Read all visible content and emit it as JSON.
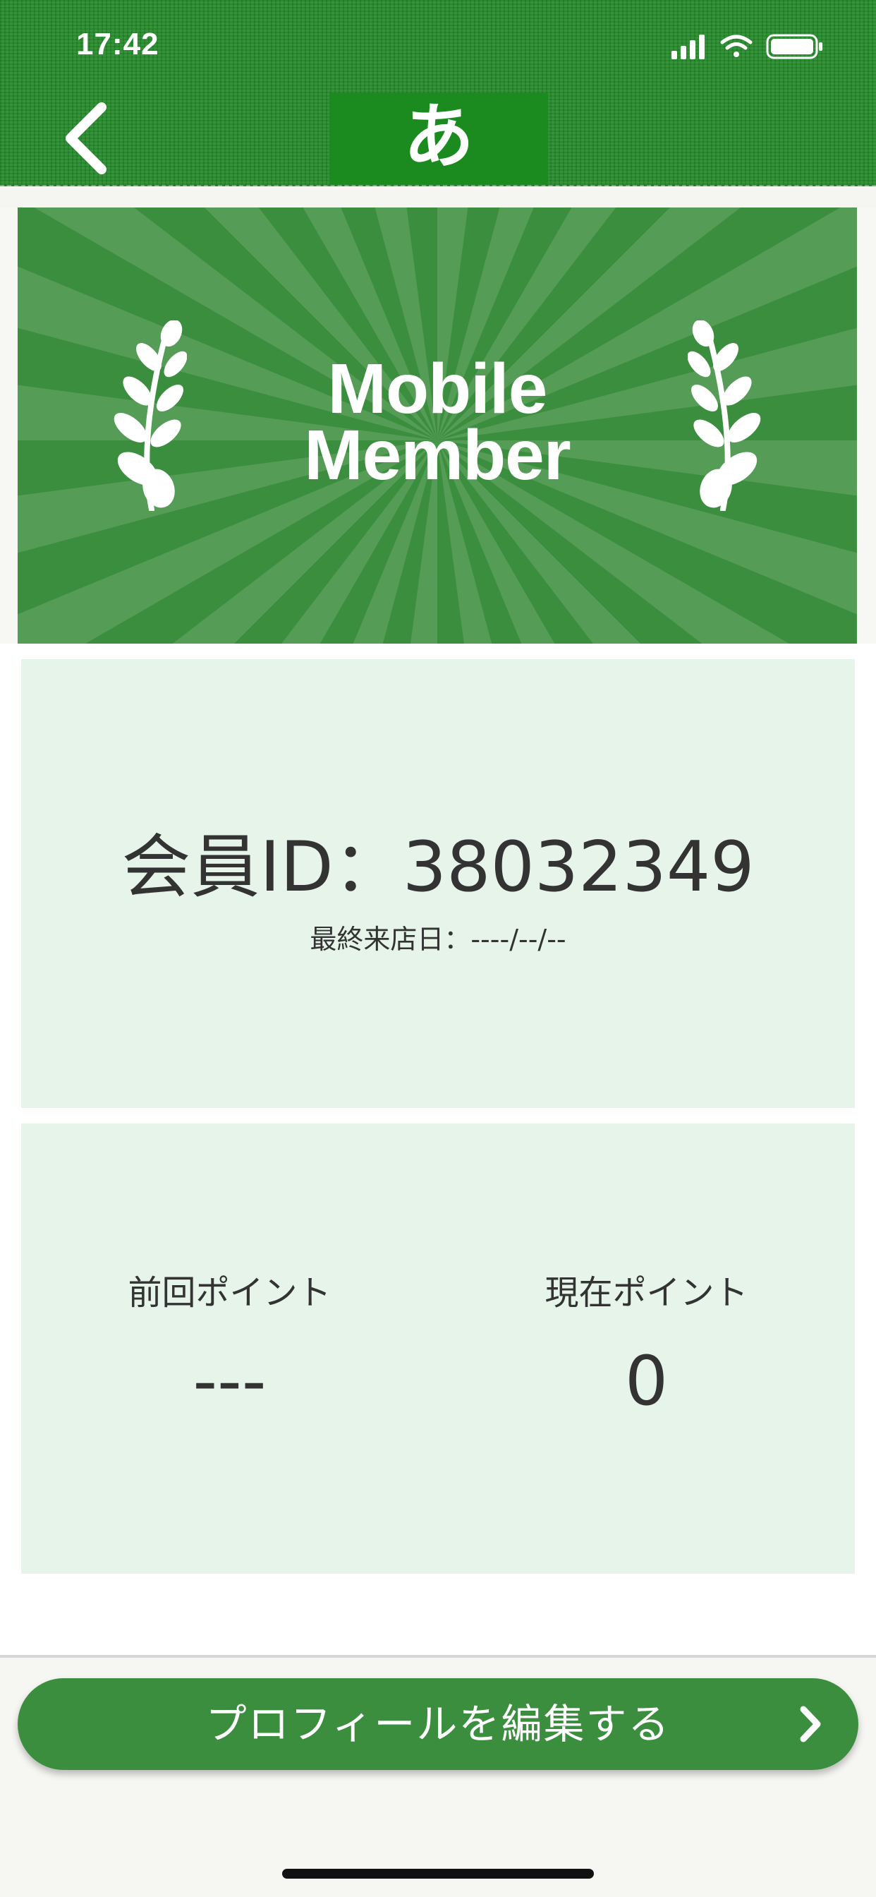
{
  "status_bar": {
    "time": "17:42"
  },
  "header": {
    "logo_text": "あ"
  },
  "banner": {
    "title_line1": "Mobile",
    "title_line2": "Member"
  },
  "member": {
    "id_text": "会員ID：38032349",
    "last_visit_text": "最終来店日：----/--/--"
  },
  "points": {
    "previous_label": "前回ポイント",
    "previous_value": "---",
    "current_label": "現在ポイント",
    "current_value": "0"
  },
  "footer": {
    "edit_profile_label": "プロフィールを編集する"
  },
  "colors": {
    "header_green": "#258a2b",
    "banner_green": "#3c8e3f",
    "card_bg": "#e6f4ea",
    "button_green": "#3a8e3d"
  }
}
